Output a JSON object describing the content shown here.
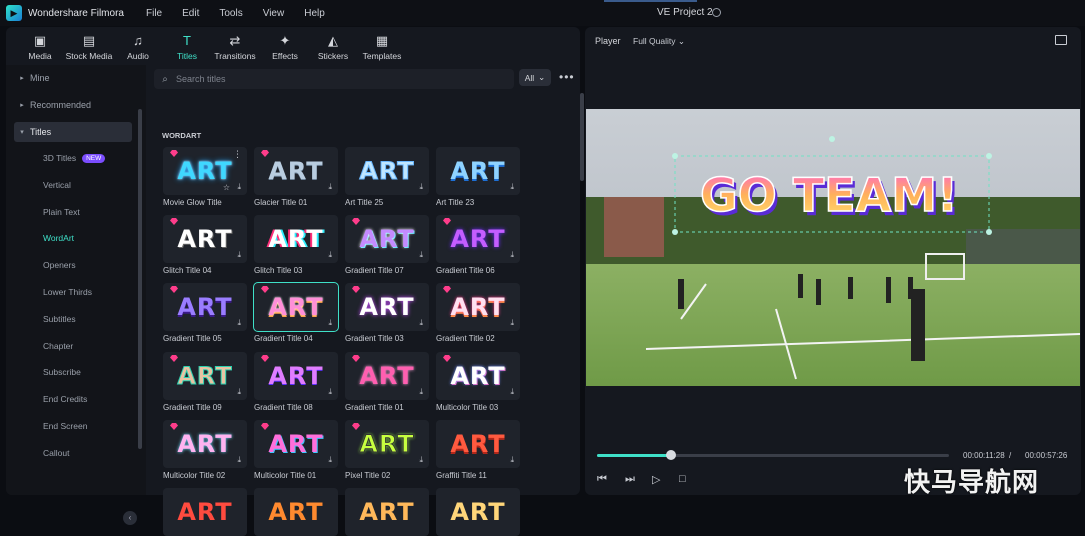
{
  "app": {
    "name": "Wondershare Filmora",
    "project": "VE Project 2"
  },
  "menu": [
    "File",
    "Edit",
    "Tools",
    "View",
    "Help"
  ],
  "toolbar": [
    {
      "label": "Media",
      "icon": "media-icon",
      "glyph": "▣"
    },
    {
      "label": "Stock Media",
      "icon": "stock-media-icon",
      "glyph": "▤"
    },
    {
      "label": "Audio",
      "icon": "audio-icon",
      "glyph": "♫"
    },
    {
      "label": "Titles",
      "icon": "titles-icon",
      "glyph": "T",
      "active": true
    },
    {
      "label": "Transitions",
      "icon": "transitions-icon",
      "glyph": "⇄"
    },
    {
      "label": "Effects",
      "icon": "effects-icon",
      "glyph": "✦"
    },
    {
      "label": "Stickers",
      "icon": "stickers-icon",
      "glyph": "◭"
    },
    {
      "label": "Templates",
      "icon": "templates-icon",
      "glyph": "▦"
    }
  ],
  "sidebar": {
    "groups": [
      {
        "label": "Mine",
        "arrow": "▸"
      },
      {
        "label": "Recommended",
        "arrow": "▸"
      },
      {
        "label": "Titles",
        "arrow": "▾",
        "selected": true
      }
    ],
    "subitems": [
      {
        "label": "3D Titles",
        "badge": "NEW"
      },
      {
        "label": "Vertical"
      },
      {
        "label": "Plain Text"
      },
      {
        "label": "WordArt",
        "active": true
      },
      {
        "label": "Openers"
      },
      {
        "label": "Lower Thirds"
      },
      {
        "label": "Subtitles"
      },
      {
        "label": "Chapter"
      },
      {
        "label": "Subscribe"
      },
      {
        "label": "End Credits"
      },
      {
        "label": "End Screen"
      },
      {
        "label": "Callout"
      }
    ]
  },
  "search": {
    "placeholder": "Search titles",
    "filter": "All"
  },
  "section": "WORDART",
  "cards": [
    {
      "name": "Movie Glow Title",
      "text": "ART",
      "gem": true,
      "style": "glow"
    },
    {
      "name": "Glacier Title 01",
      "text": "ART",
      "gem": true,
      "style": "glacier"
    },
    {
      "name": "Art Title 25",
      "text": "ART",
      "gem": false,
      "style": "ice"
    },
    {
      "name": "Art Title 23",
      "text": "ART",
      "gem": false,
      "style": "blue"
    },
    {
      "name": "Glitch Title 04",
      "text": "ART",
      "gem": true,
      "style": "white"
    },
    {
      "name": "Glitch Title 03",
      "text": "ART",
      "gem": false,
      "style": "glitch"
    },
    {
      "name": "Gradient Title 07",
      "text": "ART",
      "gem": true,
      "style": "grad7"
    },
    {
      "name": "Gradient Title 06",
      "text": "ART",
      "gem": true,
      "style": "grad6"
    },
    {
      "name": "Gradient Title 05",
      "text": "ART",
      "gem": true,
      "style": "grad5"
    },
    {
      "name": "Gradient Title 04",
      "text": "ART",
      "gem": true,
      "style": "grad4",
      "selected": true
    },
    {
      "name": "Gradient Title 03",
      "text": "ART",
      "gem": true,
      "style": "grad3"
    },
    {
      "name": "Gradient Title 02",
      "text": "ART",
      "gem": true,
      "style": "grad2"
    },
    {
      "name": "Gradient Title 09",
      "text": "ART",
      "gem": true,
      "style": "grad9"
    },
    {
      "name": "Gradient Title 08",
      "text": "ART",
      "gem": true,
      "style": "grad8"
    },
    {
      "name": "Gradient Title 01",
      "text": "ART",
      "gem": true,
      "style": "grad1"
    },
    {
      "name": "Multicolor Title 03",
      "text": "ART",
      "gem": true,
      "style": "multi3"
    },
    {
      "name": "Multicolor Title 02",
      "text": "ART",
      "gem": true,
      "style": "multi2"
    },
    {
      "name": "Multicolor Title 01",
      "text": "ART",
      "gem": true,
      "style": "multi1"
    },
    {
      "name": "Pixel Title 02",
      "text": "ART",
      "gem": true,
      "style": "pixel"
    },
    {
      "name": "Graffiti Title 11",
      "text": "ART",
      "gem": false,
      "style": "graffiti"
    },
    {
      "name": "",
      "text": "ART",
      "gem": false,
      "style": "r1"
    },
    {
      "name": "",
      "text": "ART",
      "gem": false,
      "style": "r2"
    },
    {
      "name": "",
      "text": "ART",
      "gem": false,
      "style": "r3"
    },
    {
      "name": "",
      "text": "ART",
      "gem": false,
      "style": "r4"
    }
  ],
  "player": {
    "tab": "Player",
    "quality": "Full Quality",
    "overlay_text": "GO TEAM!",
    "current_time": "00:00:11:28",
    "divider": "/",
    "total_time": "00:00:57:26",
    "progress": 0.21
  },
  "watermark": "快马导航网",
  "colors": {
    "accent": "#3fe0c8",
    "gem": "#ff3d8b",
    "badge": "#7b4dff"
  }
}
